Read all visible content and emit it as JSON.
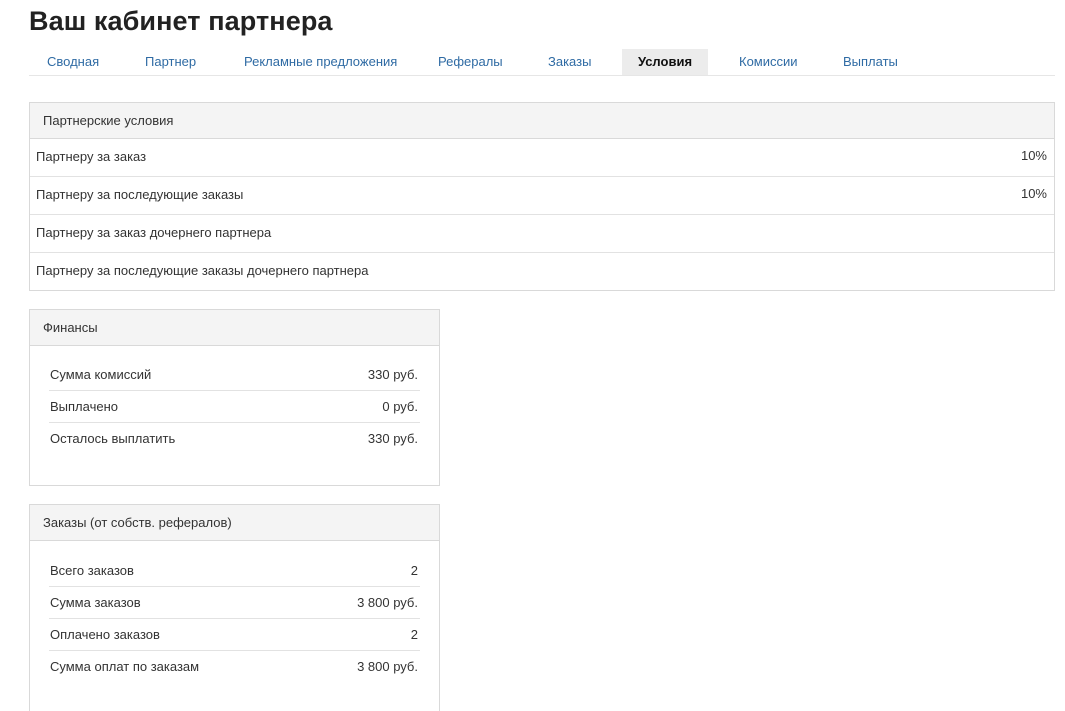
{
  "header": {
    "title": "Ваш кабинет партнера"
  },
  "tabs": [
    {
      "label": "Сводная",
      "active": false
    },
    {
      "label": "Партнер",
      "active": false
    },
    {
      "label": "Рекламные предложения",
      "active": false
    },
    {
      "label": "Рефералы",
      "active": false
    },
    {
      "label": "Заказы",
      "active": false
    },
    {
      "label": "Условия",
      "active": true
    },
    {
      "label": "Комиссии",
      "active": false
    },
    {
      "label": "Выплаты",
      "active": false
    }
  ],
  "conditions": {
    "title": "Партнерские условия",
    "rows": [
      {
        "label": "Партнеру за заказ",
        "value": "10%"
      },
      {
        "label": "Партнеру за последующие заказы",
        "value": "10%"
      },
      {
        "label": "Партнеру за заказ дочернего партнера",
        "value": ""
      },
      {
        "label": "Партнеру за последующие заказы дочернего партнера",
        "value": ""
      }
    ]
  },
  "finances": {
    "title": "Финансы",
    "rows": [
      {
        "label": "Сумма комиссий",
        "value": "330 руб."
      },
      {
        "label": "Выплачено",
        "value": "0 руб."
      },
      {
        "label": "Осталось выплатить",
        "value": "330 руб."
      }
    ]
  },
  "orders": {
    "title": "Заказы (от собств. рефералов)",
    "rows": [
      {
        "label": "Всего заказов",
        "value": "2"
      },
      {
        "label": "Сумма заказов",
        "value": "3 800 руб."
      },
      {
        "label": "Оплачено заказов",
        "value": "2"
      },
      {
        "label": "Сумма оплат по заказам",
        "value": "3 800 руб."
      }
    ]
  },
  "colors": {
    "link": "#2f6ba4",
    "active_tab_bg": "#ececec",
    "panel_head_bg": "#f4f4f4",
    "border": "#d9d9d9"
  }
}
